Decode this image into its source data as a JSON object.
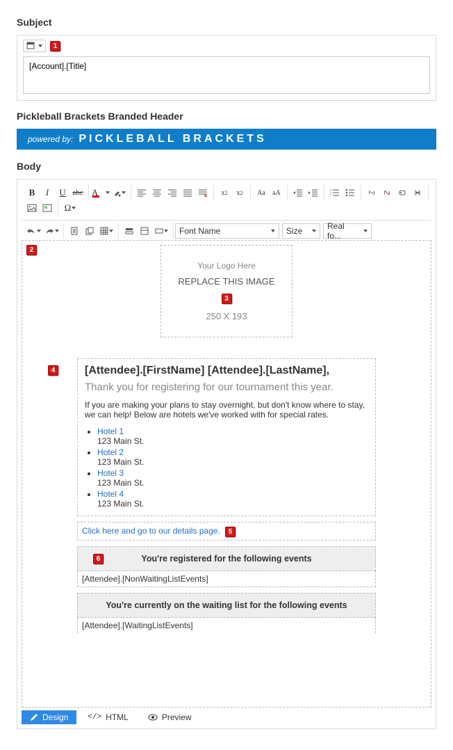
{
  "subject": {
    "label": "Subject",
    "marker": "1",
    "value": "[Account].[Title]"
  },
  "header": {
    "label": "Pickleball Brackets Branded Header",
    "powered": "powered by:",
    "brand": "PICKLEBALL BRACKETS"
  },
  "body": {
    "label": "Body",
    "marker_area": "2",
    "logo_box": {
      "line1": "Your Logo Here",
      "line2": "REPLACE THIS IMAGE",
      "line3": "250 X 193",
      "marker": "3"
    },
    "marker_content": "4",
    "greeting": "[Attendee].[FirstName] [Attendee].[LastName],",
    "thanks": "Thank you for registering for our tournament this year.",
    "para": "If you are making your plans to stay overnight, but don't know where to stay, we can help! Below are hotels we've worked with for special rates.",
    "hotels": [
      {
        "name": "Hotel 1",
        "addr": "123 Main St."
      },
      {
        "name": "Hotel 2",
        "addr": "123 Main St."
      },
      {
        "name": "Hotel 3",
        "addr": "123 Main St."
      },
      {
        "name": "Hotel 4",
        "addr": "123 Main St."
      }
    ],
    "details_link": "Click here and go to our details page.",
    "marker_link": "5",
    "registered": {
      "marker": "6",
      "title": "You're registered for the following events",
      "token": "[Attendee].[NonWaitingListEvents]"
    },
    "waiting": {
      "title": "You're currently on the waiting list for the following events",
      "token": "[Attendee].[WaitingListEvents]"
    }
  },
  "toolbar": {
    "font_name": "Font Name",
    "size": "Size",
    "real": "Real fo..."
  },
  "tabs": {
    "design": "Design",
    "html": "HTML",
    "preview": "Preview"
  }
}
